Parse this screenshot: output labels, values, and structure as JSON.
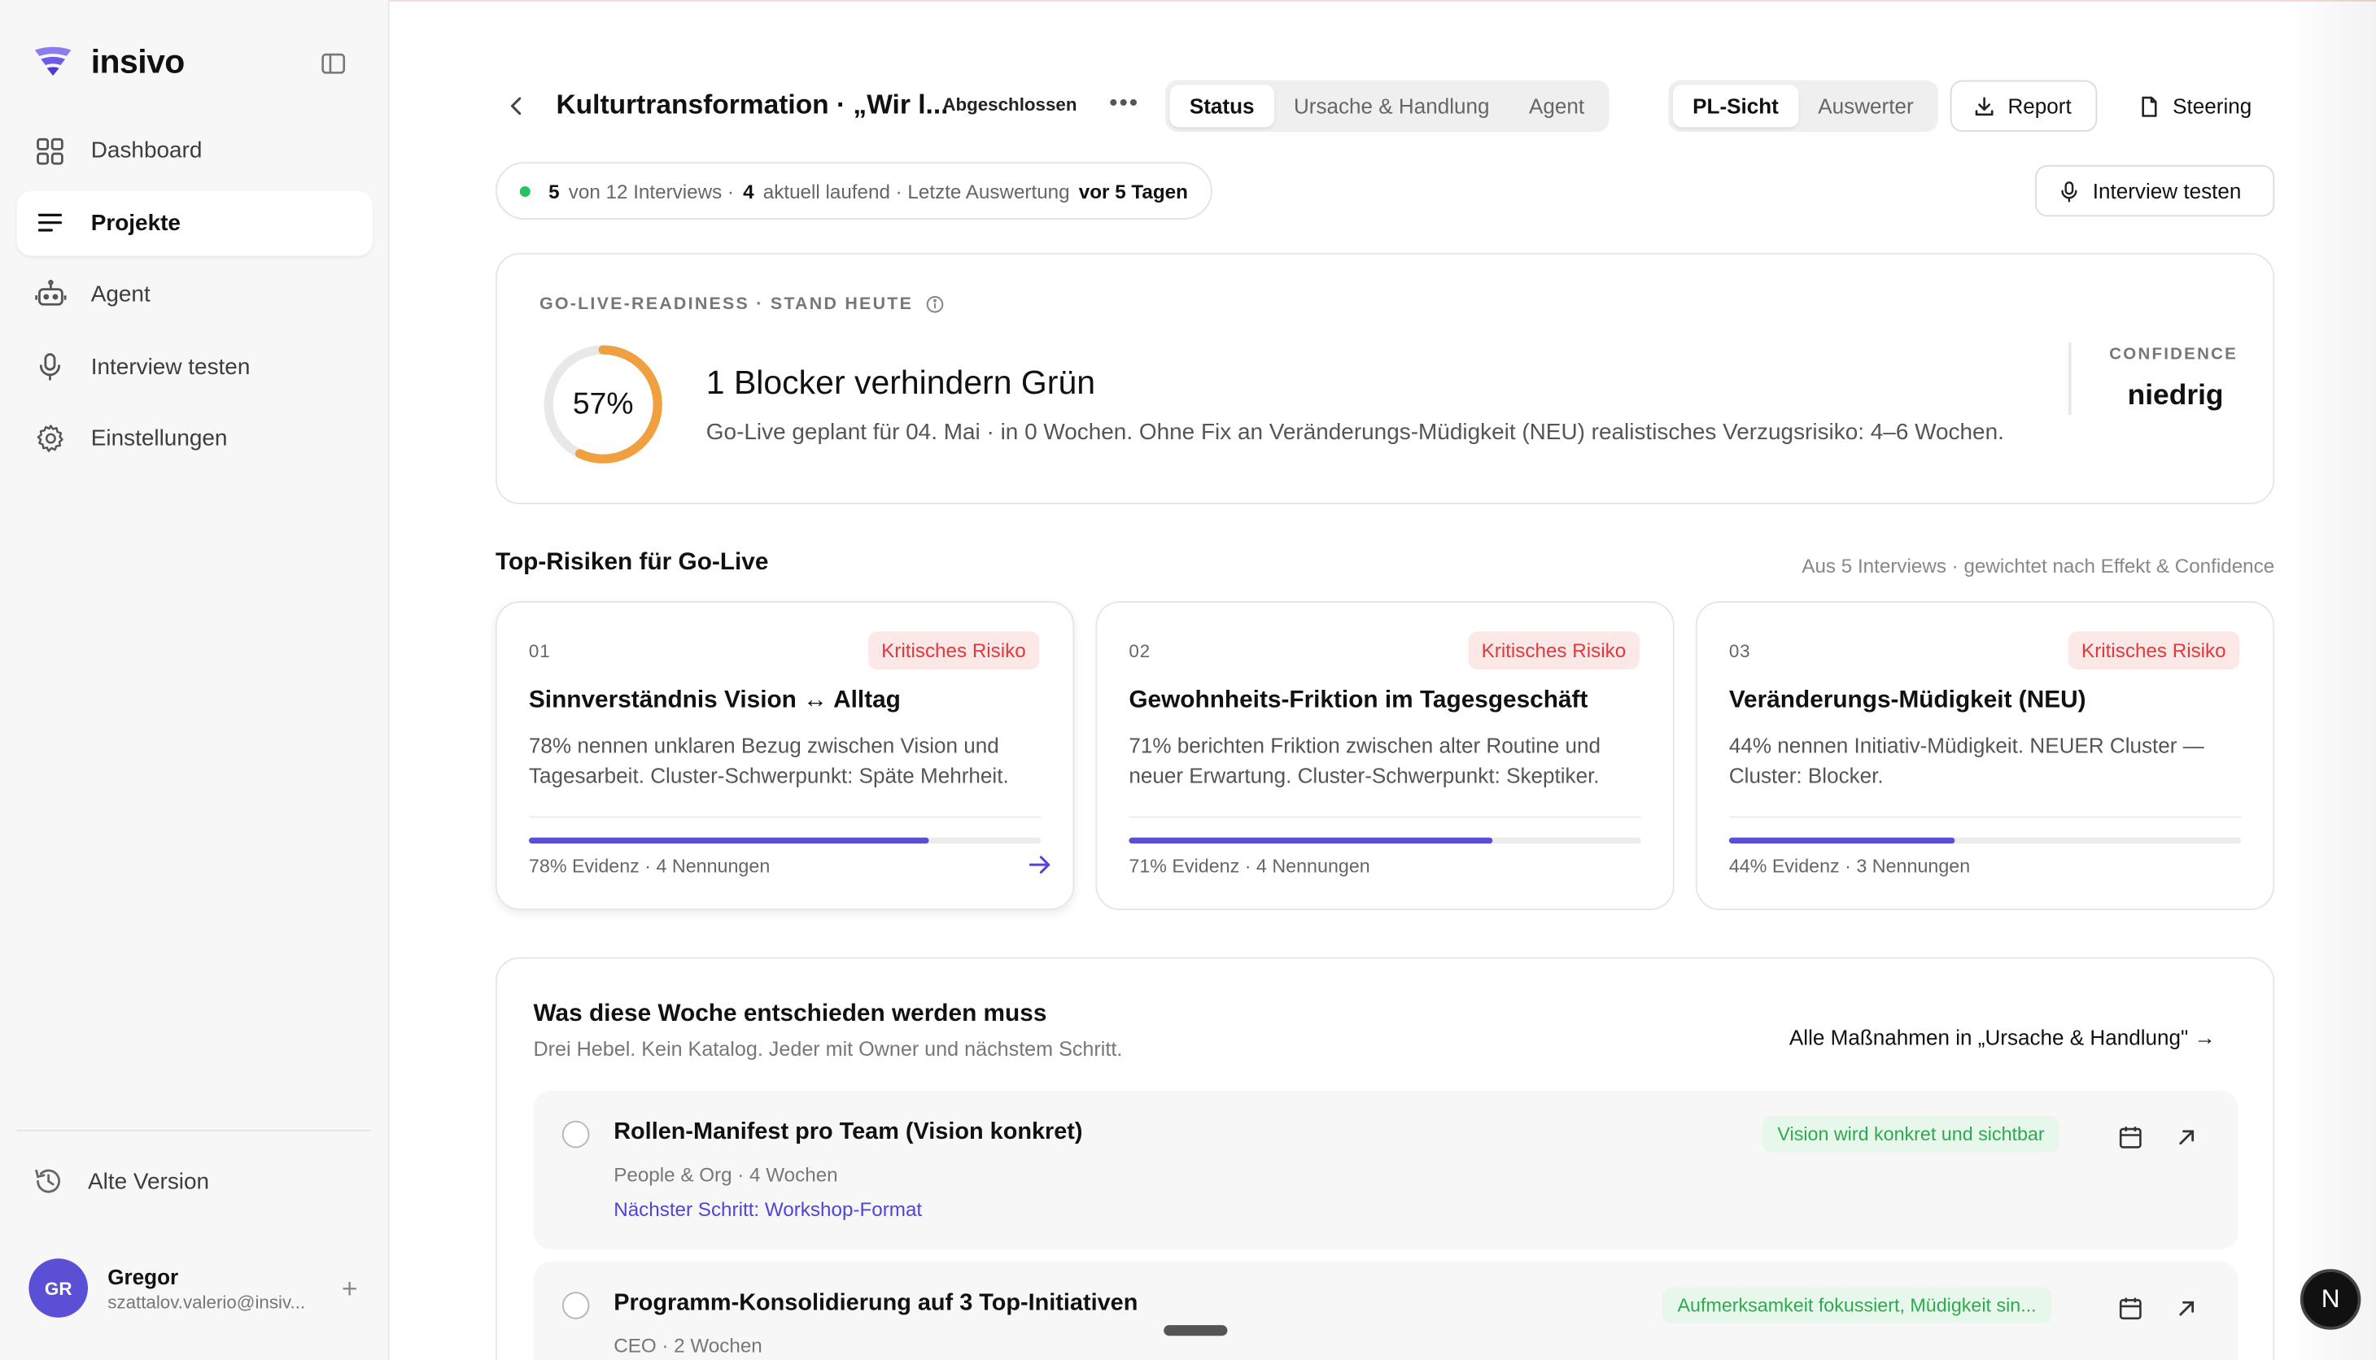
{
  "brand": {
    "name": "insivo"
  },
  "sidebar": {
    "items": [
      {
        "label": "Dashboard",
        "icon": "grid-icon",
        "active": false
      },
      {
        "label": "Projekte",
        "icon": "list-icon",
        "active": true
      },
      {
        "label": "Agent",
        "icon": "robot-icon",
        "active": false
      },
      {
        "label": "Interview testen",
        "icon": "microphone-icon",
        "active": false
      },
      {
        "label": "Einstellungen",
        "icon": "gear-icon",
        "active": false
      }
    ],
    "old_version": "Alte Version",
    "user": {
      "initials": "GR",
      "name": "Gregor",
      "email": "szattalov.valerio@insiv..."
    }
  },
  "header": {
    "title": "Kulturtransformation · „Wir l...",
    "status": "Abgeschlossen",
    "more": "•••",
    "tabs": [
      "Status",
      "Ursache & Handlung",
      "Agent"
    ],
    "active_tab": "Status",
    "views": [
      "PL-Sicht",
      "Auswerter"
    ],
    "active_view": "PL-Sicht",
    "report_label": "Report",
    "steering_label": "Steering",
    "interview_label": "Interview testen"
  },
  "status_bar": {
    "done": "5",
    "text1": "von 12 Interviews ·",
    "running": "4",
    "text2": "aktuell laufend · Letzte Auswertung",
    "last": "vor 5 Tagen"
  },
  "readiness": {
    "label": "GO-LIVE-READINESS · STAND HEUTE",
    "percent_text": "57%",
    "percent": 57,
    "title": "1 Blocker verhindern Grün",
    "subtitle": "Go-Live geplant für 04. Mai · in 0 Wochen. Ohne Fix an Veränderungs-Müdigkeit (NEU) realistisches Verzugsrisiko: 4–6 Wochen.",
    "confidence_label": "CONFIDENCE",
    "confidence_value": "niedrig",
    "colors": {
      "gauge": "#f0a040",
      "track": "#e8e8e8"
    }
  },
  "risks": {
    "title": "Top-Risiken für Go-Live",
    "meta": "Aus 5 Interviews · gewichtet nach Effekt & Confidence",
    "items": [
      {
        "num": "01",
        "badge": "Kritisches Risiko",
        "title": "Sinnverständnis Vision ↔ Alltag",
        "desc": "78% nennen unklaren Bezug zwischen Vision und Tagesarbeit. Cluster-Schwerpunkt: Späte Mehrheit.",
        "evidence": 78,
        "foot": "78% Evidenz · 4 Nennungen"
      },
      {
        "num": "02",
        "badge": "Kritisches Risiko",
        "title": "Gewohnheits-Friktion im Tagesgeschäft",
        "desc": "71% berichten Friktion zwischen alter Routine und neuer Erwartung. Cluster-Schwerpunkt: Skeptiker.",
        "evidence": 71,
        "foot": "71% Evidenz · 4 Nennungen"
      },
      {
        "num": "03",
        "badge": "Kritisches Risiko",
        "title": "Veränderungs-Müdigkeit (NEU)",
        "desc": "44% nennen Initiativ-Müdigkeit. NEUER Cluster — Cluster: Blocker.",
        "evidence": 44,
        "foot": "44% Evidenz · 3 Nennungen"
      }
    ]
  },
  "decisions": {
    "title": "Was diese Woche entschieden werden muss",
    "subtitle": "Drei Hebel. Kein Katalog. Jeder mit Owner und nächstem Schritt.",
    "link": "Alle Maßnahmen in „Ursache & Handlung\" →",
    "items": [
      {
        "title": "Rollen-Manifest pro Team (Vision konkret)",
        "meta": "People & Org · 4 Wochen",
        "next": "Nächster Schritt: Workshop-Format",
        "tag": "Vision wird konkret und sichtbar"
      },
      {
        "title": "Programm-Konsolidierung auf 3 Top-Initiativen",
        "meta": "CEO · 2 Wochen",
        "next": "",
        "tag": "Aufmerksamkeit fokussiert, Müdigkeit sin..."
      }
    ]
  },
  "misc": {
    "n_badge": "N"
  }
}
